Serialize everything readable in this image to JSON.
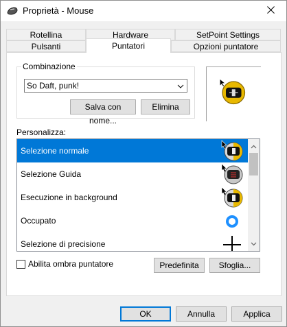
{
  "window": {
    "title": "Proprietà - Mouse"
  },
  "tabs": {
    "back_row": [
      "Rotellina",
      "Hardware",
      "SetPoint Settings"
    ],
    "front_row": [
      "Pulsanti",
      "Puntatori",
      "Opzioni puntatore"
    ],
    "active": "Puntatori"
  },
  "scheme": {
    "group_label": "Combinazione",
    "selected": "So Daft, punk!",
    "save_as_label": "Salva con nome...",
    "delete_label": "Elimina"
  },
  "customize": {
    "label": "Personalizza:",
    "items": [
      {
        "label": "Selezione normale",
        "icon": "daft-punk-helmet-cursor-icon",
        "selected": true
      },
      {
        "label": "Selezione Guida",
        "icon": "daft-punk-helmet-help-cursor-icon",
        "selected": false
      },
      {
        "label": "Esecuzione in background",
        "icon": "daft-punk-helmet-busy-cursor-icon",
        "selected": false
      },
      {
        "label": "Occupato",
        "icon": "busy-ring-icon",
        "selected": false
      },
      {
        "label": "Selezione di precisione",
        "icon": "crosshair-icon",
        "selected": false
      }
    ]
  },
  "shadow": {
    "label": "Abilita ombra puntatore",
    "checked": false
  },
  "buttons": {
    "default_label": "Predefinita",
    "browse_label": "Sfoglia...",
    "ok_label": "OK",
    "cancel_label": "Annulla",
    "apply_label": "Applica"
  },
  "colors": {
    "selection": "#0078d7",
    "accent_gold": "#f2c200"
  }
}
